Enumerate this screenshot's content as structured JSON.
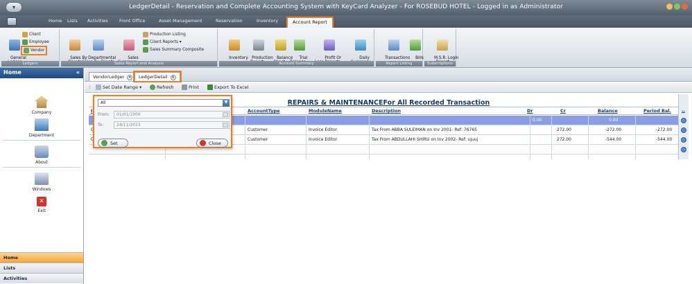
{
  "window": {
    "title": "LedgerDetail - Reservation and Complete Accounting System with KeyCard Analyzer - For ROSEBUD HOTEL - Logged in as Administrator"
  },
  "menu_tabs": [
    "Home",
    "Lists",
    "Activities",
    "Front Office",
    "Asset Management",
    "Reservation",
    "Inventory",
    "Account Report"
  ],
  "ribbon": {
    "ledgers": {
      "label": "Ledgers",
      "general_ledger": "General\nLedger",
      "client": "Client",
      "employee": "Employee",
      "vendor": "Vendor"
    },
    "sales": {
      "label": "Sales Report and Analysis",
      "sales_by_clients": "Sales By\nClients",
      "departmental": "Departmental\nSales By Clients",
      "sales_summary": "Sales\nSummary ▾",
      "production_listing": "Production Listing",
      "client_reports": "Client Reports ▾",
      "sales_summary_composite": "Sales Summary Composite"
    },
    "account_summary": {
      "label": "Account Summary",
      "inventory": "Inventory\n▾",
      "production_report": "Production\nReport ▾",
      "balance_sheet": "Balance\nSheet ▾",
      "trial_balance": "Trial\nBalance ▾",
      "profit_or_loss": "Profit Or\nLoss Reports ▾",
      "daily_summary": "Daily\nSummary"
    },
    "report_listing": {
      "label": "Report Listing",
      "transactions": "Transactions\n▾",
      "bills": "Bills\n▾"
    },
    "subscriptions": {
      "label": "Subscriptions",
      "msr_login": "M.S.R. Login\nReport"
    }
  },
  "nav": {
    "header": "Home",
    "collapse": "«",
    "items": [
      "Company",
      "Department",
      "About",
      "Windows",
      "Exit"
    ],
    "bottom": [
      "Home",
      "Lists",
      "Activities"
    ]
  },
  "doc_tabs": [
    "VendorLedger",
    "LedgerDetail"
  ],
  "toolbar": {
    "set_date_range": "Set Date Range ▾",
    "refresh": "Refresh",
    "print": "Print",
    "export": "Export To Excel"
  },
  "report": {
    "title": "REPAIRS & MAINTENANCEFor All Recorded Transaction",
    "columns": [
      "AccountType",
      "ModuleName",
      "Description",
      "Dr",
      "Cr",
      "Balance",
      "Period Bal."
    ],
    "rows": [
      {
        "account_type": "",
        "module": "",
        "description": "",
        "dr": "0.00",
        "cr": "",
        "balance": "0.00",
        "period": ""
      },
      {
        "account_type": "Customer",
        "module": "Invoice Editor",
        "description": "Tax From ABBA SULEIMAN on Inv 2001- Ref: 76765",
        "dr": "",
        "cr": "272.00",
        "balance": "-272.00",
        "period": "-272.00"
      },
      {
        "account_type": "Customer",
        "module": "Invoice Editor",
        "description": "Tax From ABDULLAHI SHIRU on Inv 2002- Ref: ujuuj",
        "dr": "",
        "cr": "272.00",
        "balance": "-544.00",
        "period": "-544.00"
      }
    ]
  },
  "date_popup": {
    "range": "All",
    "from_label": "From:",
    "from_value": "01/01/1900",
    "to_label": "To:",
    "to_value": "24/11/2013",
    "set_label": "Set",
    "close_label": "Close"
  },
  "colors": {
    "highlight": "#f07f1a",
    "selected_row": "#8a9ee6",
    "nav_header": "#1f4c80"
  }
}
